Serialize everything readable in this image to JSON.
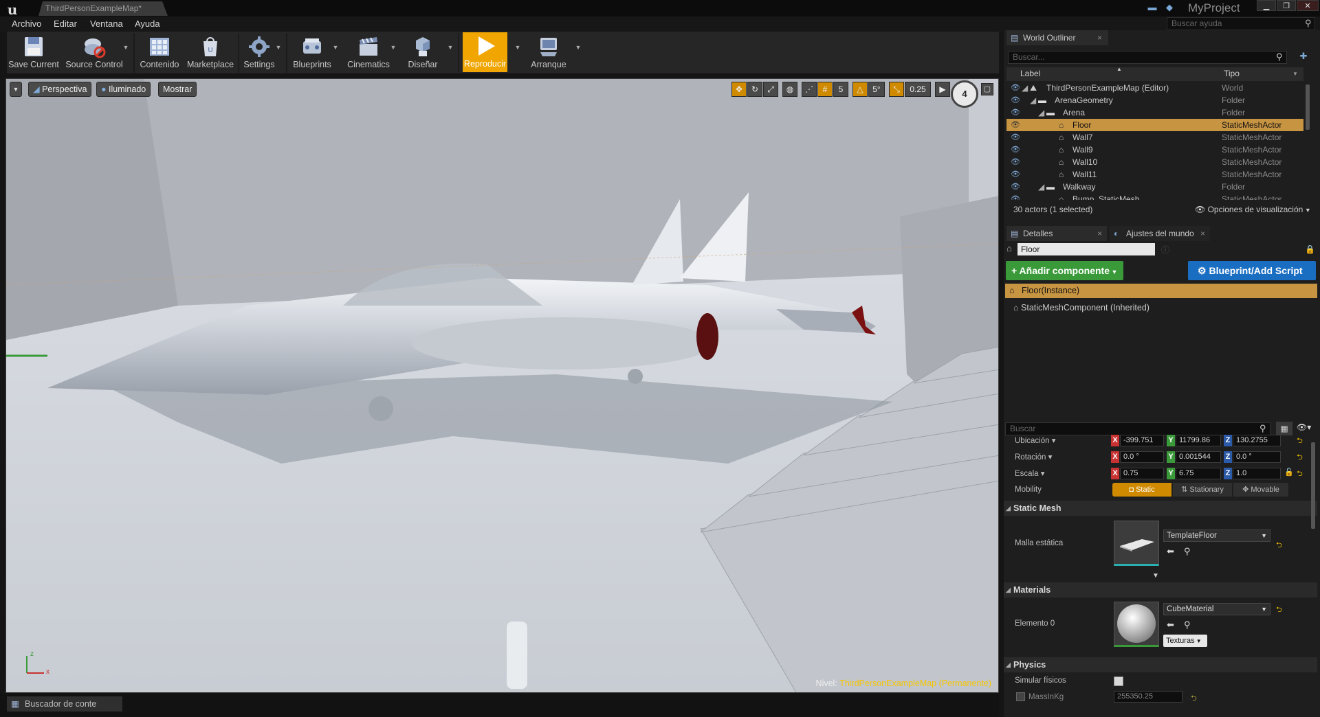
{
  "window": {
    "doc_tab": "ThirdPersonExampleMap*",
    "project": "MyProject",
    "minimize": "▁",
    "maximize": "❐",
    "close": "✕"
  },
  "menu": {
    "items": [
      "Archivo",
      "Editar",
      "Ventana",
      "Ayuda"
    ],
    "help_placeholder": "Buscar ayuda"
  },
  "toolbar": {
    "save": "Save Current",
    "source": "Source Control",
    "content": "Contenido",
    "marketplace": "Marketplace",
    "settings": "Settings",
    "blueprints": "Blueprints",
    "cinematics": "Cinematics",
    "design": "Diseñar",
    "play": "Reproducir",
    "launch": "Arranque"
  },
  "viewport": {
    "perspective": "Perspectiva",
    "lit": "Iluminado",
    "show": "Mostrar",
    "grid_snap": "5",
    "rot_snap": "5°",
    "scale_snap": "0.25",
    "cam_speed": "4",
    "level_label": "Nivel:",
    "level_name": "ThirdPersonExampleMap (Permanente)"
  },
  "content_browser": {
    "tab": "Buscador de conte"
  },
  "outliner": {
    "tab": "World Outliner",
    "search_placeholder": "Buscar...",
    "col_label": "Label",
    "col_type": "Tipo",
    "rows": [
      {
        "label": "ThirdPersonExampleMap (Editor)",
        "type": "World"
      },
      {
        "label": "ArenaGeometry",
        "type": "Folder"
      },
      {
        "label": "Arena",
        "type": "Folder"
      },
      {
        "label": "Floor",
        "type": "StaticMeshActor"
      },
      {
        "label": "Wall7",
        "type": "StaticMeshActor"
      },
      {
        "label": "Wall9",
        "type": "StaticMeshActor"
      },
      {
        "label": "Wall10",
        "type": "StaticMeshActor"
      },
      {
        "label": "Wall11",
        "type": "StaticMeshActor"
      },
      {
        "label": "Walkway",
        "type": "Folder"
      },
      {
        "label": "Bump_StaticMesh",
        "type": "StaticMeshActor"
      }
    ],
    "status": "30 actors (1 selected)",
    "view_options": "Opciones de visualización"
  },
  "details": {
    "tab": "Detalles",
    "world_tab": "Ajustes del mundo",
    "name_value": "Floor",
    "add_component": "+ Añadir componente",
    "blueprint_script": "Blueprint/Add Script",
    "instance": "Floor(Instance)",
    "component": "StaticMeshComponent (Inherited)",
    "search_placeholder": "Buscar",
    "location_label": "Ubicación",
    "rotation_label": "Rotación",
    "scale_label": "Escala",
    "mobility_label": "Mobility",
    "loc": [
      "-399.751",
      "11799.86",
      "130.2755"
    ],
    "rot": [
      "0.0 °",
      "0.001544",
      "0.0 °"
    ],
    "scale": [
      "0.75",
      "6.75",
      "1.0"
    ],
    "mobility": [
      "Static",
      "Stationary",
      "Movable"
    ],
    "static_mesh_section": "Static Mesh",
    "static_mesh_label": "Malla estática",
    "static_mesh_value": "TemplateFloor",
    "materials_section": "Materials",
    "element_label": "Elemento 0",
    "material_value": "CubeMaterial",
    "textures": "Texturas",
    "physics_section": "Physics",
    "simulate_label": "Simular físicos",
    "mass_label": "MassInKg",
    "mass_value": "255350.25"
  },
  "colors": {
    "accent": "#f0a500",
    "selection": "#c79442",
    "add_green": "#3a9a3a",
    "blueprint_blue": "#1a6ec2"
  }
}
